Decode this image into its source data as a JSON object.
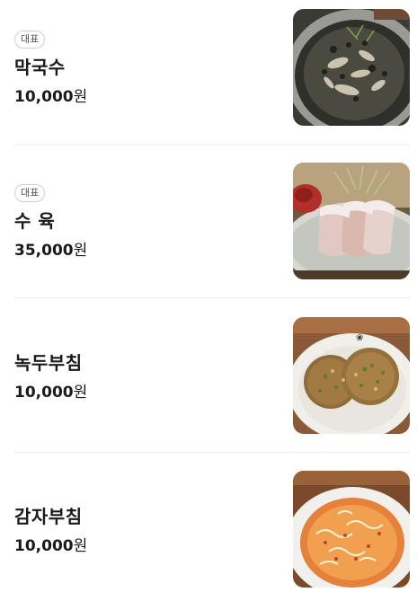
{
  "menu": {
    "items": [
      {
        "badge": "대표",
        "name": "막국수",
        "price": "10,000",
        "unit": "원",
        "image": "makguksu-photo"
      },
      {
        "badge": "대표",
        "name": "수 육",
        "price": "35,000",
        "unit": "원",
        "image": "suyuk-photo"
      },
      {
        "badge": "",
        "name": "녹두부침",
        "price": "10,000",
        "unit": "원",
        "image": "nokdu-buchim-photo"
      },
      {
        "badge": "",
        "name": "감자부침",
        "price": "10,000",
        "unit": "원",
        "image": "gamja-buchim-photo"
      }
    ]
  }
}
